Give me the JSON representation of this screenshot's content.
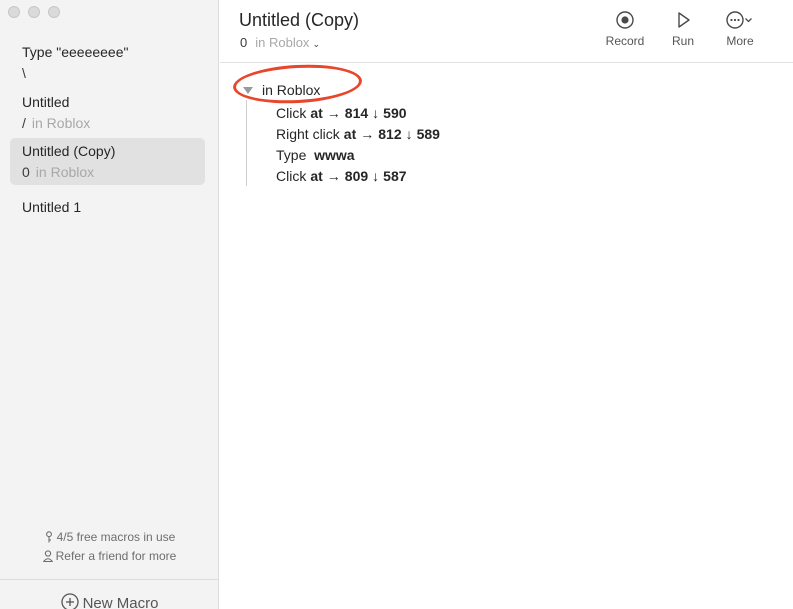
{
  "sidebar": {
    "macros": [
      {
        "title": "Type \"eeeeeeee\"",
        "symbol": "\\",
        "app": ""
      },
      {
        "title": "Untitled",
        "symbol": "/",
        "app": "in Roblox"
      },
      {
        "title": "Untitled (Copy)",
        "symbol": "0",
        "app": "in Roblox"
      },
      {
        "title": "Untitled 1",
        "symbol": "",
        "app": ""
      }
    ],
    "free_macros": "4/5 free macros in use",
    "refer": "Refer a friend for more",
    "new_macro": "New Macro"
  },
  "header": {
    "title": "Untitled (Copy)",
    "count": "0",
    "app": "in Roblox",
    "chevron": "⌄",
    "toolbar": {
      "record": "Record",
      "run": "Run",
      "more": "More"
    }
  },
  "group": {
    "in_label": "in",
    "app": "Roblox"
  },
  "steps": [
    {
      "action": "Click",
      "kw": "at",
      "x": "814",
      "y": "590"
    },
    {
      "action": "Right click",
      "kw": "at",
      "x": "812",
      "y": "589"
    },
    {
      "action": "Type",
      "value": "wwwa"
    },
    {
      "action": "Click",
      "kw": "at",
      "x": "809",
      "y": "587"
    }
  ],
  "arrows": {
    "right": "→",
    "down": "↓"
  },
  "colors": {
    "annotation": "#e8452a",
    "sidebar_bg": "#f3f3f3",
    "selected_bg": "#e1e1e1",
    "muted_text": "#a8a8a8"
  },
  "icons": {
    "record": "record-icon",
    "run": "play-icon",
    "more": "ellipsis-circle-icon",
    "key": "key-icon",
    "person": "person-icon",
    "add": "plus-circle-icon"
  }
}
